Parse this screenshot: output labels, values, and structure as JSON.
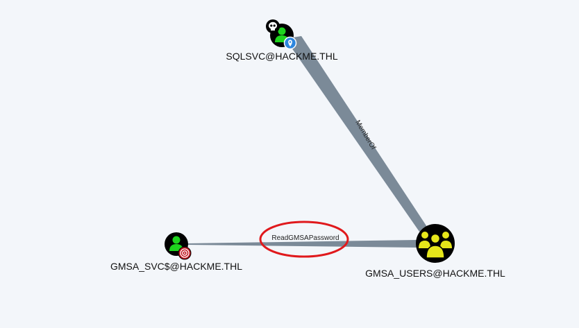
{
  "graph": {
    "nodes": {
      "sqlsvc": {
        "label": "SQLSVC@HACKME.THL",
        "type": "user",
        "badges": [
          "skull-icon",
          "map-pin-icon"
        ]
      },
      "gmsa_users": {
        "label": "GMSA_USERS@HACKME.THL",
        "type": "group",
        "badges": []
      },
      "gmsa_svc": {
        "label": "GMSA_SVC$@HACKME.THL",
        "type": "user",
        "badges": [
          "target-icon"
        ]
      }
    },
    "edges": {
      "memberof": {
        "label": "MemberOf",
        "from": "sqlsvc",
        "to": "gmsa_users"
      },
      "readgmsa": {
        "label": "ReadGMSAPassword",
        "from": "gmsa_svc",
        "to": "gmsa_users"
      }
    },
    "highlight": {
      "target_edge": "readgmsa",
      "color": "#e0191c"
    }
  },
  "colors": {
    "background": "#f3f6fa",
    "edge": "#7b8a98",
    "user_icon": "#1ed41e",
    "group_icon": "#e6e61a",
    "node_fill": "#000000",
    "pin": "#2e86de",
    "target": "#c0161f"
  }
}
